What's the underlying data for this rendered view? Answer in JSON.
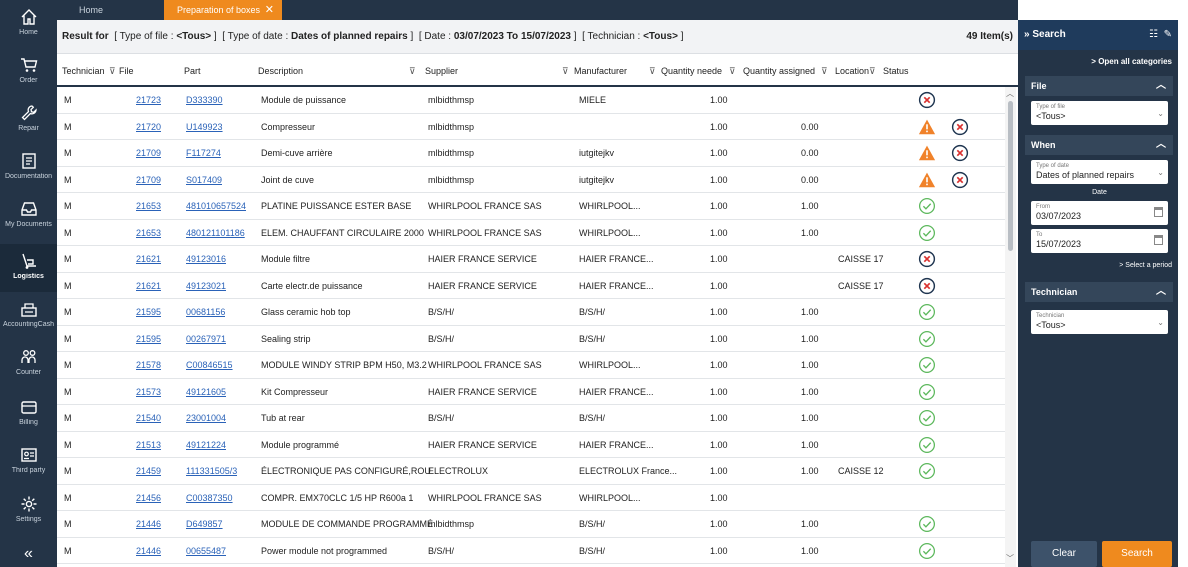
{
  "nav": {
    "items": [
      {
        "label": "Home",
        "icon": "home-icon"
      },
      {
        "label": "Order",
        "icon": "cart-icon"
      },
      {
        "label": "Repair",
        "icon": "wrench-icon"
      },
      {
        "label": "Documentation",
        "icon": "book-icon"
      },
      {
        "label": "My Documents",
        "icon": "tray-icon"
      },
      {
        "label": "Logistics",
        "icon": "dolly-icon"
      },
      {
        "label": "AccountingCash",
        "icon": "register-icon"
      },
      {
        "label": "Counter",
        "icon": "people-icon"
      },
      {
        "label": "Billing",
        "icon": "wallet-icon"
      },
      {
        "label": "Third party",
        "icon": "id-card-icon"
      },
      {
        "label": "Settings",
        "icon": "gear-icon"
      }
    ],
    "collapse": "«"
  },
  "tabs": {
    "home": "Home",
    "active": "Preparation of boxes",
    "close": "✕"
  },
  "result": {
    "prefix": "Result for",
    "f1a": "[ Type of file : ",
    "f1b": "<Tous>",
    "f1c": " ]",
    "f2a": "[ Type of date : ",
    "f2b": "Dates of planned repairs",
    "f2c": " ]",
    "f3a": "[ Date : ",
    "f3b": "03/07/2023 To 15/07/2023",
    "f3c": " ]",
    "f4a": "[ Technician : ",
    "f4b": "<Tous>",
    "f4c": " ]",
    "count": "49 Item(s)"
  },
  "columns": {
    "technician": "Technician",
    "file": "File",
    "part": "Part",
    "description": "Description",
    "supplier": "Supplier",
    "manufacturer": "Manufacturer",
    "qty_needed": "Quantity neede",
    "qty_assigned": "Quantity assigned",
    "location": "Location",
    "status": "Status"
  },
  "rows": [
    {
      "tech": "M",
      "file": "21723",
      "part": "D333390",
      "desc": "Module de puissance",
      "supplier": "mlbidthmsp",
      "manu": "MIELE",
      "qn": "1.00",
      "qa": "",
      "loc": "",
      "status": "cancel",
      "extra": ""
    },
    {
      "tech": "M",
      "file": "21720",
      "part": "U149923",
      "desc": "Compresseur",
      "supplier": "mlbidthmsp",
      "manu": "",
      "qn": "1.00",
      "qa": "0.00",
      "loc": "",
      "status": "warning",
      "extra": "cancel"
    },
    {
      "tech": "M",
      "file": "21709",
      "part": "F117274",
      "desc": "Demi-cuve arrière",
      "supplier": "mlbidthmsp",
      "manu": "iutgitejkv",
      "qn": "1.00",
      "qa": "0.00",
      "loc": "",
      "status": "warning",
      "extra": "cancel"
    },
    {
      "tech": "M",
      "file": "21709",
      "part": "S017409",
      "desc": "Joint de cuve",
      "supplier": "mlbidthmsp",
      "manu": "iutgitejkv",
      "qn": "1.00",
      "qa": "0.00",
      "loc": "",
      "status": "warning",
      "extra": "cancel"
    },
    {
      "tech": "M",
      "file": "21653",
      "part": "481010657524",
      "desc": "PLATINE PUISSANCE ESTER BASE",
      "supplier": "WHIRLPOOL FRANCE SAS",
      "manu": "WHIRLPOOL...",
      "qn": "1.00",
      "qa": "1.00",
      "loc": "",
      "status": "ok",
      "extra": ""
    },
    {
      "tech": "M",
      "file": "21653",
      "part": "480121101186",
      "desc": "ELEM. CHAUFFANT CIRCULAIRE 2000",
      "supplier": "WHIRLPOOL FRANCE SAS",
      "manu": "WHIRLPOOL...",
      "qn": "1.00",
      "qa": "1.00",
      "loc": "",
      "status": "ok",
      "extra": ""
    },
    {
      "tech": "M",
      "file": "21621",
      "part": "49123016",
      "desc": "Module filtre",
      "supplier": "HAIER FRANCE SERVICE",
      "manu": "HAIER FRANCE...",
      "qn": "1.00",
      "qa": "",
      "loc": "CAISSE 17",
      "status": "cancel",
      "extra": ""
    },
    {
      "tech": "M",
      "file": "21621",
      "part": "49123021",
      "desc": "Carte electr.de puissance",
      "supplier": "HAIER FRANCE SERVICE",
      "manu": "HAIER FRANCE...",
      "qn": "1.00",
      "qa": "",
      "loc": "CAISSE 17",
      "status": "cancel",
      "extra": ""
    },
    {
      "tech": "M",
      "file": "21595",
      "part": "00681156",
      "desc": "Glass ceramic hob top",
      "supplier": "B/S/H/",
      "manu": "B/S/H/",
      "qn": "1.00",
      "qa": "1.00",
      "loc": "",
      "status": "ok",
      "extra": ""
    },
    {
      "tech": "M",
      "file": "21595",
      "part": "00267971",
      "desc": "Sealing strip",
      "supplier": "B/S/H/",
      "manu": "B/S/H/",
      "qn": "1.00",
      "qa": "1.00",
      "loc": "",
      "status": "ok",
      "extra": ""
    },
    {
      "tech": "M",
      "file": "21578",
      "part": "C00846515",
      "desc": "MODULE WINDY STRIP BPM H50, M3.2",
      "supplier": "WHIRLPOOL FRANCE SAS",
      "manu": "WHIRLPOOL...",
      "qn": "1.00",
      "qa": "1.00",
      "loc": "",
      "status": "ok",
      "extra": ""
    },
    {
      "tech": "M",
      "file": "21573",
      "part": "49121605",
      "desc": "Kit Compresseur",
      "supplier": "HAIER FRANCE SERVICE",
      "manu": "HAIER FRANCE...",
      "qn": "1.00",
      "qa": "1.00",
      "loc": "",
      "status": "ok",
      "extra": ""
    },
    {
      "tech": "M",
      "file": "21540",
      "part": "23001004",
      "desc": "Tub at rear",
      "supplier": "B/S/H/",
      "manu": "B/S/H/",
      "qn": "1.00",
      "qa": "1.00",
      "loc": "",
      "status": "ok",
      "extra": ""
    },
    {
      "tech": "M",
      "file": "21513",
      "part": "49121224",
      "desc": "Module programmé",
      "supplier": "HAIER FRANCE SERVICE",
      "manu": "HAIER FRANCE...",
      "qn": "1.00",
      "qa": "1.00",
      "loc": "",
      "status": "ok",
      "extra": ""
    },
    {
      "tech": "M",
      "file": "21459",
      "part": "111331505/3",
      "desc": "ÉLECTRONIQUE PAS CONFIGURÉ,ROU",
      "supplier": "ELECTROLUX",
      "manu": "ELECTROLUX France...",
      "qn": "1.00",
      "qa": "1.00",
      "loc": "CAISSE 12",
      "status": "ok",
      "extra": ""
    },
    {
      "tech": "M",
      "file": "21456",
      "part": "C00387350",
      "desc": "COMPR.  EMX70CLC  1/5 HP R600a 1",
      "supplier": "WHIRLPOOL FRANCE SAS",
      "manu": "WHIRLPOOL...",
      "qn": "1.00",
      "qa": "",
      "loc": "",
      "status": "",
      "extra": ""
    },
    {
      "tech": "M",
      "file": "21446",
      "part": "D649857",
      "desc": "MODULE DE COMMANDE PROGRAMMÉ",
      "supplier": "mlbidthmsp",
      "manu": "B/S/H/",
      "qn": "1.00",
      "qa": "1.00",
      "loc": "",
      "status": "ok",
      "extra": ""
    },
    {
      "tech": "M",
      "file": "21446",
      "part": "00655487",
      "desc": "Power module not programmed",
      "supplier": "B/S/H/",
      "manu": "B/S/H/",
      "qn": "1.00",
      "qa": "1.00",
      "loc": "",
      "status": "ok",
      "extra": ""
    }
  ],
  "panel": {
    "title": "Search",
    "open_all": "> Open all categories",
    "file_section": "File",
    "file_type_label": "Type of file",
    "file_type_value": "<Tous>",
    "when_section": "When",
    "date_type_label": "Type of date",
    "date_type_value": "Dates of planned repairs",
    "date_label": "Date",
    "from_label": "From",
    "from_value": "03/07/2023",
    "to_label": "To",
    "to_value": "15/07/2023",
    "select_period": "> Select a period",
    "tech_section": "Technician",
    "tech_label": "Technician",
    "tech_value": "<Tous>",
    "clear": "Clear",
    "search": "Search"
  },
  "colors": {
    "nav": "#243447",
    "accent": "#ef8a1e",
    "link": "#2a62b8",
    "ok": "#5cb85c",
    "cancel": "#1f3550",
    "warning": "#f0822a"
  }
}
